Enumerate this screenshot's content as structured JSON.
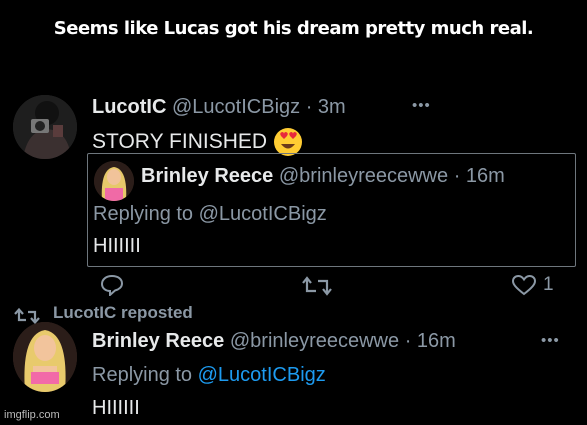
{
  "caption": "Seems like Lucas got his dream pretty much real.",
  "post": {
    "display_name": "LucotIC",
    "handle": "@LucotICBigz",
    "time": "· 3m",
    "text": "STORY FINISHED",
    "emoji": "heart-eyes-emoji",
    "more_label": "•••",
    "likes": "1"
  },
  "quoted": {
    "display_name": "Brinley Reece",
    "handle": "@brinleyreecewwe",
    "time": "· 16m",
    "reply_prefix": "Replying to",
    "reply_handle": "@LucotICBigz",
    "text": "HIIIIII"
  },
  "repost": {
    "label": "LucotIC reposted",
    "display_name": "Brinley Reece",
    "handle": "@brinleyreecewwe",
    "time": "· 16m",
    "more_label": "•••",
    "reply_prefix": "Replying to",
    "reply_handle": "@LucotICBigz",
    "text": "HIIIIII"
  },
  "watermark": "imgflip.com",
  "colors": {
    "background": "#000000",
    "link": "#1d9bf0",
    "muted": "#8b98a5",
    "text": "#e7e9ea"
  }
}
